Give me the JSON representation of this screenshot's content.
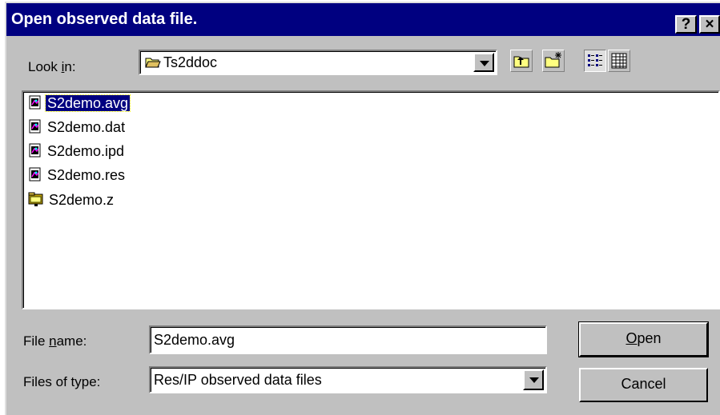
{
  "window": {
    "title": "Open observed data file.",
    "help_glyph": "?",
    "close_glyph": "×"
  },
  "lookin": {
    "label_pre": "Look ",
    "label_hot": "i",
    "label_post": "n:",
    "value": "Ts2ddoc",
    "icon": "folder-open-icon"
  },
  "toolbar": {
    "up_icon": "up-one-level-icon",
    "newfolder_icon": "new-folder-icon",
    "list_icon": "list-view-icon",
    "details_icon": "details-view-icon"
  },
  "files": [
    {
      "name": "S2demo.avg",
      "icon": "data-file-icon",
      "selected": true
    },
    {
      "name": "S2demo.dat",
      "icon": "data-file-icon",
      "selected": false
    },
    {
      "name": "S2demo.ipd",
      "icon": "data-file-icon",
      "selected": false
    },
    {
      "name": "S2demo.res",
      "icon": "data-file-icon",
      "selected": false
    },
    {
      "name": "S2demo.z",
      "icon": "archive-file-icon",
      "selected": false
    }
  ],
  "filename": {
    "label_pre": "File ",
    "label_hot": "n",
    "label_post": "ame:",
    "value": "S2demo.avg"
  },
  "filetype": {
    "label": "Files of type:",
    "value": "Res/IP observed data files"
  },
  "buttons": {
    "open_hot": "O",
    "open_rest": "pen",
    "cancel": "Cancel"
  },
  "colors": {
    "title_bar": "#000080",
    "face": "#c0c0c0",
    "selection": "#000080"
  }
}
